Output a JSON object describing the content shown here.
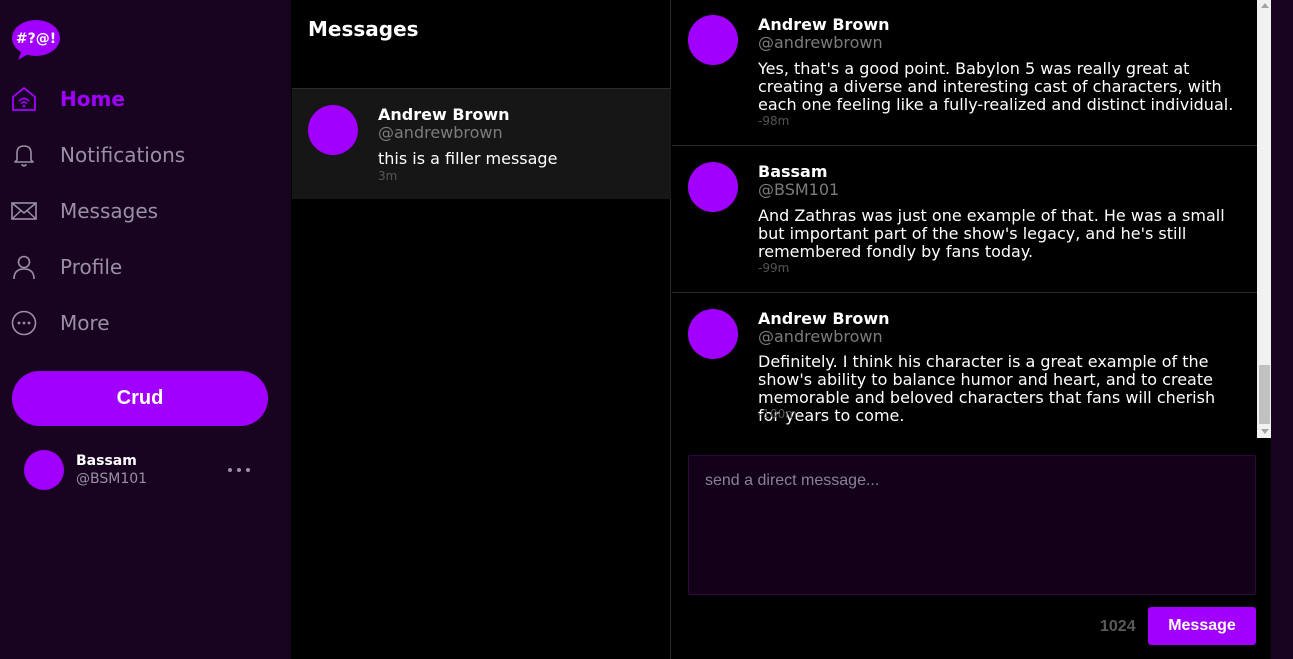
{
  "app": {
    "logo_text": "#?@!",
    "colors": {
      "accent": "#a100ff",
      "sidebar_bg": "#180421",
      "panel_bg": "#000000"
    }
  },
  "sidebar": {
    "items": [
      {
        "label": "Home",
        "icon": "home-icon",
        "active": true
      },
      {
        "label": "Notifications",
        "icon": "bell-icon",
        "active": false
      },
      {
        "label": "Messages",
        "icon": "envelope-icon",
        "active": false
      },
      {
        "label": "Profile",
        "icon": "user-icon",
        "active": false
      },
      {
        "label": "More",
        "icon": "more-circle-icon",
        "active": false
      }
    ],
    "crud_label": "Crud",
    "current_user": {
      "name": "Bassam",
      "handle": "@BSM101"
    }
  },
  "conversations": {
    "title": "Messages",
    "items": [
      {
        "name": "Andrew Brown",
        "handle": "@andrewbrown",
        "preview": "this is a filler message",
        "time": "3m"
      }
    ]
  },
  "thread": {
    "messages": [
      {
        "name": "Andrew Brown",
        "handle": "@andrewbrown",
        "text": "Yes, that's a good point. Babylon 5 was really great at creating a diverse and interesting cast of characters, with each one feeling like a fully-realized and distinct individual.",
        "time": "-98m"
      },
      {
        "name": "Bassam",
        "handle": "@BSM101",
        "text": "And Zathras was just one example of that. He was a small but important part of the show's legacy, and he's still remembered fondly by fans today.",
        "time": "-99m"
      },
      {
        "name": "Andrew Brown",
        "handle": "@andrewbrown",
        "text": "Definitely. I think his character is a great example of the show's ability to balance humor and heart, and to create memorable and beloved characters that fans will cherish for years to come.",
        "time": "-100m"
      }
    ],
    "input_placeholder": "send a direct message...",
    "input_value": "",
    "char_count": "1024",
    "send_label": "Message"
  }
}
